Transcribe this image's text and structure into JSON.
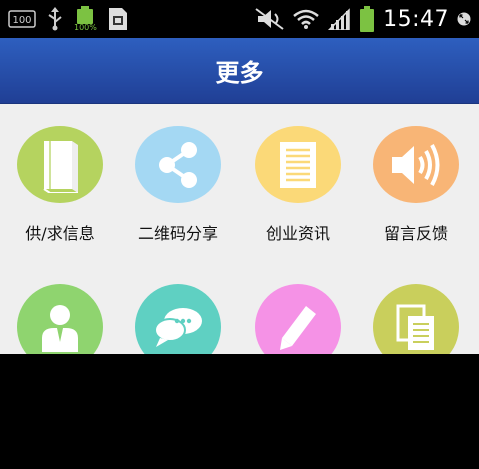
{
  "status_bar": {
    "left_icons": [
      "storage-100-icon",
      "usb-icon",
      "battery-100-icon",
      "app-notification-icon"
    ],
    "battery_left_label": "100%",
    "right_icons": [
      "mute-icon",
      "wifi-icon",
      "signal-icon",
      "battery-icon",
      "fullscreen-icon"
    ],
    "time": "15:47"
  },
  "header": {
    "title": "更多"
  },
  "grid": {
    "items": [
      {
        "label": "供/求信息",
        "icon": "book-icon",
        "color": "#b5d35f"
      },
      {
        "label": "二维码分享",
        "icon": "share-icon",
        "color": "#a4d8f3"
      },
      {
        "label": "创业资讯",
        "icon": "news-icon",
        "color": "#fbd978"
      },
      {
        "label": "留言反馈",
        "icon": "speaker-icon",
        "color": "#f8b576"
      },
      {
        "label": "",
        "icon": "user-icon",
        "color": "#8fd46f"
      },
      {
        "label": "",
        "icon": "chat-icon",
        "color": "#5fd0c2"
      },
      {
        "label": "",
        "icon": "pencil-icon",
        "color": "#f592e6"
      },
      {
        "label": "",
        "icon": "documents-icon",
        "color": "#c9cf5c"
      }
    ]
  }
}
